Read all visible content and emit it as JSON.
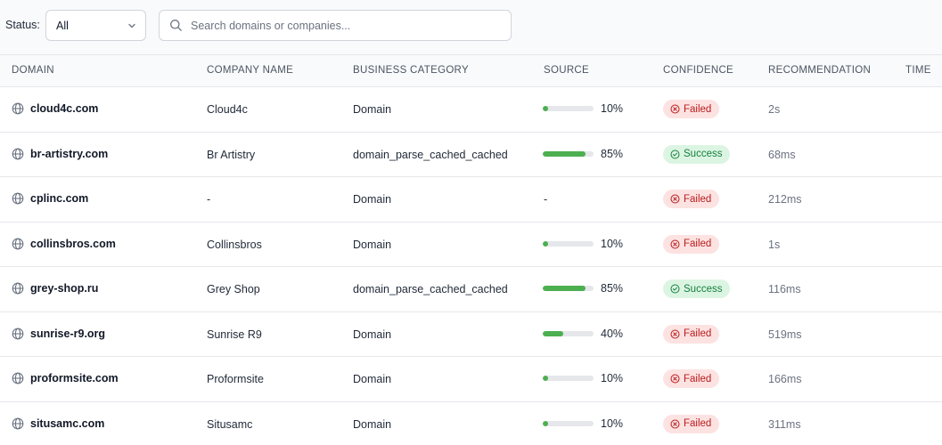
{
  "filters": {
    "status_label": "Status:",
    "status_value": "All",
    "search_placeholder": "Search domains or companies..."
  },
  "columns": [
    "DOMAIN",
    "COMPANY NAME",
    "BUSINESS CATEGORY",
    "SOURCE",
    "CONFIDENCE",
    "RECOMMENDATION",
    "TIME"
  ],
  "rows": [
    {
      "domain": "cloud4c.com",
      "company": "Cloud4c",
      "category": "Domain",
      "source_pct": 10,
      "source_label": "10%",
      "status": "Failed",
      "time": "2s"
    },
    {
      "domain": "br-artistry.com",
      "company": "Br Artistry",
      "category": "domain_parse_cached_cached",
      "source_pct": 85,
      "source_label": "85%",
      "status": "Success",
      "time": "68ms"
    },
    {
      "domain": "cplinc.com",
      "company": "-",
      "category": "Domain",
      "source_pct": null,
      "source_label": "-",
      "status": "Failed",
      "time": "212ms"
    },
    {
      "domain": "collinsbros.com",
      "company": "Collinsbros",
      "category": "Domain",
      "source_pct": 10,
      "source_label": "10%",
      "status": "Failed",
      "time": "1s"
    },
    {
      "domain": "grey-shop.ru",
      "company": "Grey Shop",
      "category": "domain_parse_cached_cached",
      "source_pct": 85,
      "source_label": "85%",
      "status": "Success",
      "time": "116ms"
    },
    {
      "domain": "sunrise-r9.org",
      "company": "Sunrise R9",
      "category": "Domain",
      "source_pct": 40,
      "source_label": "40%",
      "status": "Failed",
      "time": "519ms"
    },
    {
      "domain": "proformsite.com",
      "company": "Proformsite",
      "category": "Domain",
      "source_pct": 10,
      "source_label": "10%",
      "status": "Failed",
      "time": "166ms"
    },
    {
      "domain": "situsamc.com",
      "company": "Situsamc",
      "category": "Domain",
      "source_pct": 10,
      "source_label": "10%",
      "status": "Failed",
      "time": "311ms"
    }
  ],
  "colors": {
    "bar_fill": "#4caf50",
    "failed_bg": "#fde2e2",
    "failed_text": "#b91c1c",
    "success_bg": "#dcf5e3",
    "success_text": "#15803d"
  }
}
